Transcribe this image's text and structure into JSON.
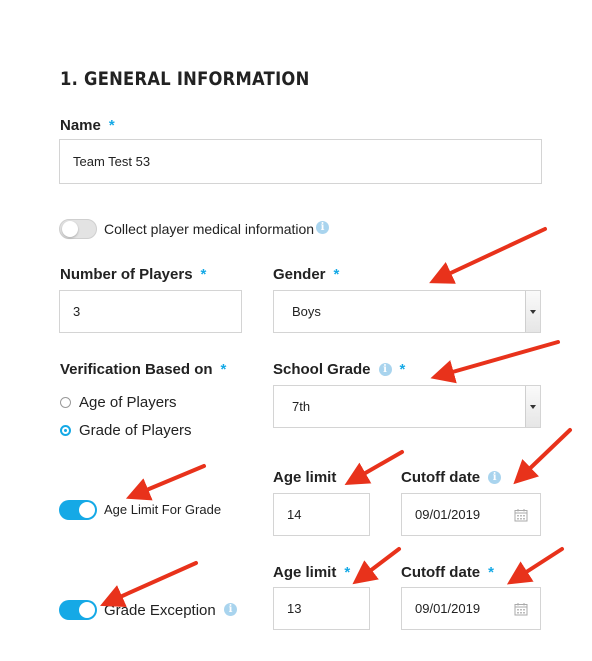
{
  "section": {
    "title": "1. GENERAL INFORMATION"
  },
  "name_field": {
    "label": "Name",
    "required": "*",
    "value": "Team Test 53"
  },
  "medical_toggle": {
    "label": "Collect player medical information",
    "info": "i"
  },
  "players_field": {
    "label": "Number of Players",
    "required": "*",
    "value": "3"
  },
  "gender_field": {
    "label": "Gender",
    "required": "*",
    "selected": "Boys"
  },
  "verification": {
    "label": "Verification Based on",
    "required": "*",
    "options": [
      "Age of Players",
      "Grade of Players"
    ],
    "selected_index": 1
  },
  "school_grade": {
    "label": "School Grade",
    "info": "i",
    "required": "*",
    "selected": "7th"
  },
  "age_limit_row1": {
    "toggle_label": "Age Limit For Grade",
    "age_label": "Age limit",
    "age_value": "14",
    "cutoff_label": "Cutoff date",
    "cutoff_info": "i",
    "cutoff_value": "09/01/2019"
  },
  "age_limit_row2": {
    "toggle_label": "Grade Exception",
    "toggle_info": "i",
    "age_label": "Age limit",
    "age_required": "*",
    "age_value": "13",
    "cutoff_label": "Cutoff date",
    "cutoff_required": "*",
    "cutoff_value": "09/01/2019"
  },
  "colors": {
    "accent": "#15a9e6",
    "annotation_arrow": "#e8321b"
  }
}
